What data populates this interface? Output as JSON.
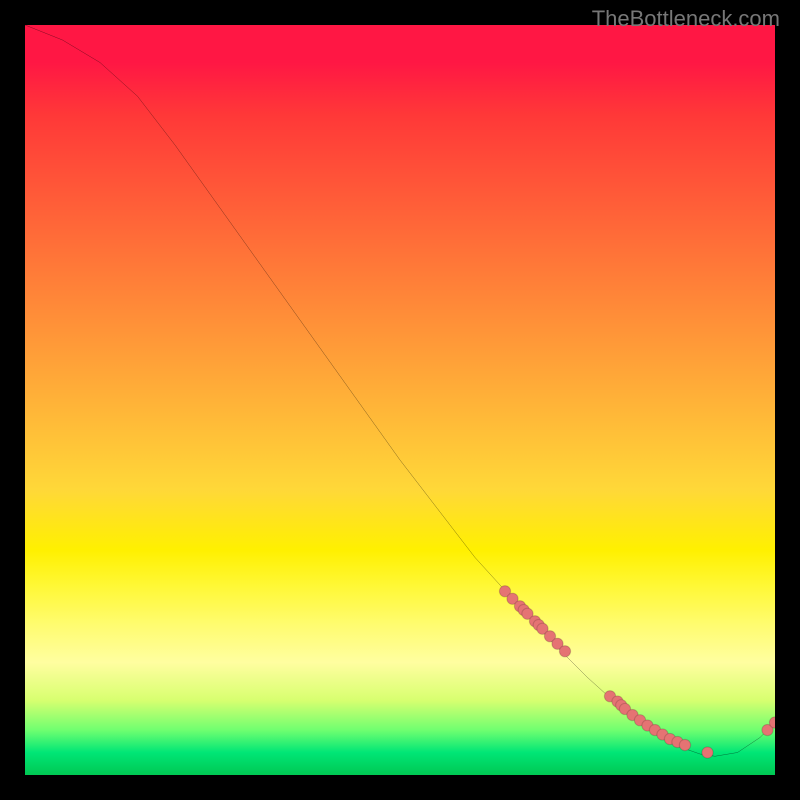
{
  "watermark": "TheBottleneck.com",
  "chart_data": {
    "type": "line",
    "title": "",
    "xlabel": "",
    "ylabel": "",
    "xlim": [
      0,
      100
    ],
    "ylim": [
      0,
      100
    ],
    "series": [
      {
        "name": "curve",
        "x": [
          0,
          5,
          10,
          15,
          20,
          25,
          30,
          35,
          40,
          45,
          50,
          55,
          60,
          65,
          70,
          75,
          80,
          85,
          88,
          90,
          92,
          95,
          98,
          100
        ],
        "y": [
          100,
          98,
          95,
          90.5,
          84,
          77,
          70,
          63,
          56,
          49,
          42,
          35.5,
          29,
          23.5,
          18,
          13,
          8.5,
          5,
          3.5,
          2.8,
          2.5,
          3,
          5,
          7
        ]
      }
    ],
    "scatter_points": {
      "name": "dots",
      "x": [
        64,
        65,
        66,
        66.5,
        67,
        68,
        68.5,
        69,
        70,
        71,
        72,
        78,
        79,
        79.5,
        80,
        81,
        82,
        83,
        84,
        85,
        86,
        87,
        88,
        91,
        99,
        100
      ],
      "y": [
        24.5,
        23.5,
        22.5,
        22,
        21.5,
        20.5,
        20,
        19.5,
        18.5,
        17.5,
        16.5,
        10.5,
        9.8,
        9.3,
        8.8,
        8,
        7.3,
        6.6,
        6,
        5.4,
        4.8,
        4.4,
        4,
        3,
        6,
        7
      ]
    },
    "gradient_stops": [
      {
        "pos": 0,
        "color": "#ff1744"
      },
      {
        "pos": 50,
        "color": "#ffc838"
      },
      {
        "pos": 75,
        "color": "#fff838"
      },
      {
        "pos": 95,
        "color": "#00e676"
      },
      {
        "pos": 100,
        "color": "#00c853"
      }
    ]
  }
}
